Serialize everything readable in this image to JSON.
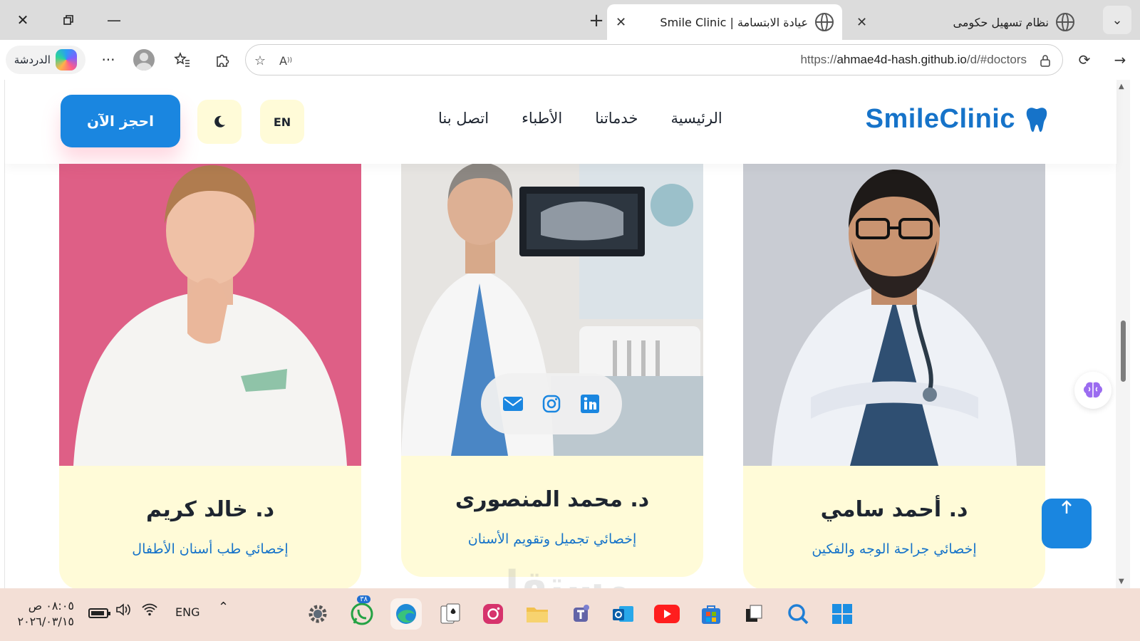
{
  "browser": {
    "tabs": [
      {
        "title": "نظام تسهيل حكومى",
        "active": false
      },
      {
        "title": "عيادة الابتسامة | Smile Clinic",
        "active": true
      }
    ],
    "url_prefix": "https://",
    "url_host": "ahmae4d-hash.github.io",
    "url_path": "/d/#doctors",
    "chat_label": "الدردشة"
  },
  "site": {
    "logo_text": "SmileClinic",
    "nav": [
      "الرئيسية",
      "خدماتنا",
      "الأطباء",
      "اتصل بنا"
    ],
    "lang_label": "EN",
    "book_label": "احجز الآن",
    "brand_color": "#1673c9",
    "accent_color": "#1a86e0",
    "card_bg": "#fffbd8"
  },
  "doctors": [
    {
      "name": "د. أحمد سامي",
      "specialty": "إخصائي جراحة الوجه والفكين"
    },
    {
      "name": "د. محمد المنصورى",
      "specialty": "إخصائي تجميل وتقويم الأسنان"
    },
    {
      "name": "د. خالد كريم",
      "specialty": "إخصائي طب أسنان الأطفال"
    }
  ],
  "socials": [
    "linkedin-icon",
    "instagram-icon",
    "mail-icon"
  ],
  "taskbar": {
    "time": "٠٨:٠٥ ص",
    "date": "٢٠٢٦/٠٣/١٥",
    "lang": "ENG",
    "whatsapp_badge": "٣٨"
  },
  "watermark": "مستقل"
}
